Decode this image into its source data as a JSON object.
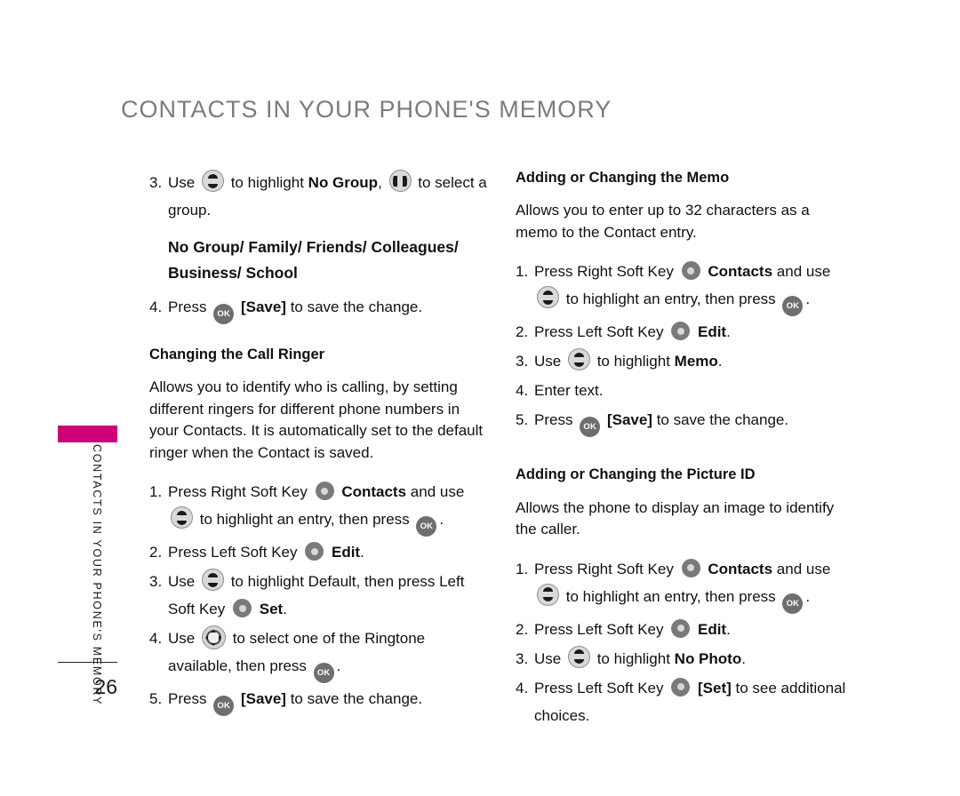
{
  "header": {
    "title": "CONTACTS IN YOUR PHONE'S MEMORY",
    "title_color": "#7c7c7c"
  },
  "sidebar": {
    "tab_color": "#CE0079",
    "vertical_label": "CONTACTS IN YOUR PHONE'S MEMORY",
    "page_number": "26"
  },
  "icons": {
    "up_down": "up-down-rocker-icon",
    "left_right": "left-right-rocker-icon",
    "ok_key": "OK",
    "soft_key": "soft-key-icon",
    "nav_pad": "four-way-navigation-icon"
  },
  "left_column": {
    "step3": {
      "num": "3.",
      "t1": "Use",
      "t2": "to highlight",
      "b1": "No Group",
      "t3": ",",
      "t4": "to select a group."
    },
    "group_list_line1": "No Group/ Family/ Friends/ Colleagues/",
    "group_list_line2": "Business/ School",
    "step4": {
      "num": "4.",
      "t1": "Press",
      "b1": "[Save]",
      "t2": "to save the change."
    },
    "section": {
      "heading": "Changing the Call Ringer",
      "body": "Allows you to identify who is calling, by setting different ringers for different phone numbers in your Contacts. It is automatically set to the default ringer when the Contact is saved."
    },
    "steps": {
      "s1": {
        "num": "1.",
        "t1": "Press Right Soft Key",
        "b1": "Contacts",
        "t2": "and use",
        "t3": "to highlight an entry, then press",
        "t4": "."
      },
      "s2": {
        "num": "2.",
        "t1": "Press Left Soft Key",
        "b1": "Edit",
        "t2": "."
      },
      "s3": {
        "num": "3.",
        "t1": "Use",
        "t2": "to highlight Default, then press Left Soft Key",
        "b1": "Set",
        "t3": "."
      },
      "s4": {
        "num": "4.",
        "t1": "Use",
        "t2": "to select one of the Ringtone available, then press",
        "t3": "."
      },
      "s5": {
        "num": "5.",
        "t1": "Press",
        "b1": "[Save]",
        "t2": "to save the change."
      }
    }
  },
  "right_column": {
    "memo": {
      "heading": "Adding or Changing the Memo",
      "body": "Allows you to enter up to 32 characters as a memo to the Contact entry.",
      "steps": {
        "s1": {
          "num": "1.",
          "t1": "Press Right Soft Key",
          "b1": "Contacts",
          "t2": "and use",
          "t3": "to highlight an entry, then press",
          "t4": "."
        },
        "s2": {
          "num": "2.",
          "t1": "Press Left Soft Key",
          "b1": "Edit",
          "t2": "."
        },
        "s3": {
          "num": "3.",
          "t1": "Use",
          "t2": "to highlight",
          "b1": "Memo",
          "t3": "."
        },
        "s4": {
          "num": "4.",
          "t1": "Enter text."
        },
        "s5": {
          "num": "5.",
          "t1": "Press",
          "b1": "[Save]",
          "t2": "to save the change."
        }
      }
    },
    "picture_id": {
      "heading": "Adding or Changing the Picture ID",
      "body": "Allows the phone to display an image to identify the caller.",
      "steps": {
        "s1": {
          "num": "1.",
          "t1": "Press Right Soft Key",
          "b1": "Contacts",
          "t2": "and use",
          "t3": "to highlight an entry, then press",
          "t4": "."
        },
        "s2": {
          "num": "2.",
          "t1": "Press Left Soft Key",
          "b1": "Edit",
          "t2": "."
        },
        "s3": {
          "num": "3.",
          "t1": "Use",
          "t2": "to highlight",
          "b1": "No Photo",
          "t3": "."
        },
        "s4": {
          "num": "4.",
          "t1": "Press Left Soft Key",
          "b1": "[Set]",
          "t2": "to see additional choices."
        }
      }
    }
  }
}
